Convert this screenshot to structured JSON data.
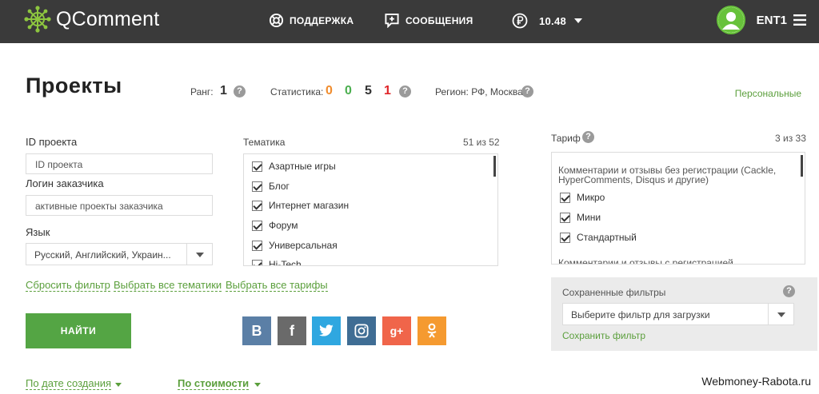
{
  "header": {
    "logo_text": "QComment",
    "nav": {
      "support": "ПОДДЕРЖКА",
      "messages": "СООБЩЕНИЯ",
      "balance": "10.48"
    },
    "user_name": "ENT1"
  },
  "page": {
    "title": "Проекты",
    "rank_label": "Ранг:",
    "rank_value": "1",
    "stats_label": "Статистика:",
    "stats": [
      {
        "value": "0",
        "color": "#f08c2d"
      },
      {
        "value": "0",
        "color": "#4caf50"
      },
      {
        "value": "5",
        "color": "#333333"
      },
      {
        "value": "1",
        "color": "#e0262a"
      }
    ],
    "region_label": "Регион: РФ, Москва",
    "personal_link": "Персональные"
  },
  "filters": {
    "project_id_label": "ID проекта",
    "project_id_placeholder": "ID проекта",
    "customer_login_label": "Логин заказчика",
    "customer_login_placeholder": "активные проекты заказчика",
    "language_label": "Язык",
    "language_value": "Русский, Английский, Украин...",
    "topics_label": "Тематика",
    "topics_count": "51 из 52",
    "topics": [
      "Азартные игры",
      "Блог",
      "Интернет магазин",
      "Форум",
      "Универсальная",
      "Hi-Tech"
    ],
    "tariff_label": "Тариф",
    "tariff_count": "3 из 33",
    "tariff_group_1": "Комментарии и отзывы без регистрации (Cackle, HyperComments, Disqus и другие)",
    "tariffs": [
      "Микро",
      "Мини",
      "Стандартный"
    ],
    "tariff_group_2": "Комментарии и отзывы с регистрацией",
    "reset_link": "Сбросить фильтр",
    "select_all_topics_link": "Выбрать все тематики",
    "select_all_tariffs_link": "Выбрать все тарифы",
    "find_button": "НАЙТИ",
    "saved_filters_label": "Сохраненные фильтры",
    "saved_filters_select": "Выберите фильтр для загрузки",
    "save_filter_link": "Сохранить фильтр"
  },
  "social": [
    {
      "icon": "vk-icon",
      "glyph": "B",
      "color": "#5b7fa6"
    },
    {
      "icon": "facebook-icon",
      "glyph": "f",
      "color": "#6a6a6a"
    },
    {
      "icon": "twitter-icon",
      "glyph": "",
      "color": "#2fa7e0"
    },
    {
      "icon": "instagram-icon",
      "glyph": "",
      "color": "#3f6d94"
    },
    {
      "icon": "google-plus-icon",
      "glyph": "g+",
      "color": "#f0654a"
    },
    {
      "icon": "odnoklassniki-icon",
      "glyph": "",
      "color": "#f59a30"
    }
  ],
  "sort": {
    "by_date": "По дате создания",
    "by_price": "По стоимости"
  },
  "watermark": "Webmoney-Rabota.ru"
}
